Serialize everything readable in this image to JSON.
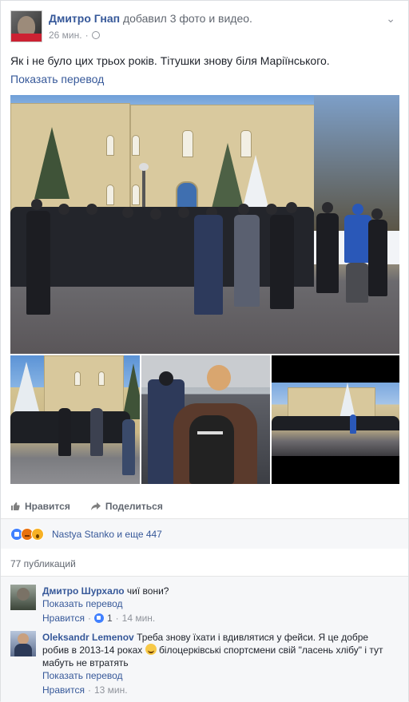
{
  "post": {
    "author": "Дмитро Гнап",
    "action": "добавил 3 фото и видео.",
    "time": "26 мин.",
    "text": "Як і не було цих трьох років. Тітушки знову біля Маріїнського.",
    "translate_label": "Показать перевод"
  },
  "actions": {
    "like_label": "Нравится",
    "share_label": "Поделиться"
  },
  "reactions": {
    "summary": "Nastya Stanko и еще 447",
    "icons": [
      "like-reaction",
      "angry-reaction",
      "wow-reaction"
    ]
  },
  "shares": "77 публикаций",
  "comments": [
    {
      "author": "Дмитро Шурхало",
      "text": "чиї вони?",
      "translate_label": "Показать перевод",
      "like_label": "Нравится",
      "likes": "1",
      "time": "14 мин."
    },
    {
      "author": "Oleksandr Lemenov",
      "text_part1": "Треба знову їхати і вдивлятися у фейси. Я це добре робив в 2013-14 роках",
      "text_part2": "білоцерківські спортсмени свій \"ласень хлібу\" і тут мабуть не втратять",
      "translate_label": "Показать перевод",
      "like_label": "Нравится",
      "time": "13 мин."
    }
  ],
  "colors": {
    "link": "#365899",
    "muted": "#90949c",
    "like_blue": "#4080ff"
  }
}
